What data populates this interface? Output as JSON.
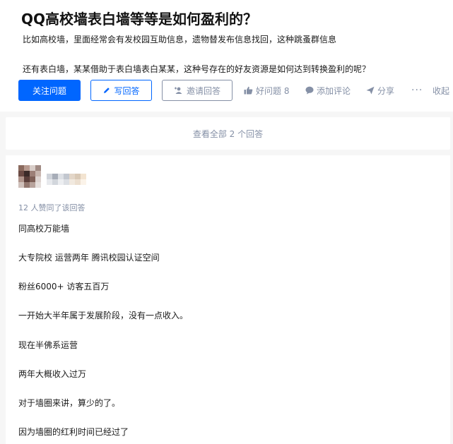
{
  "question": {
    "title": "QQ高校墙表白墙等等是如何盈利的？",
    "detail_1": "比如高校墙，里面经常会有发校园互助信息，遗物替发布信息找回，这种跳蚤群信息",
    "detail_2": "还有表白墙，某某借助于表白墙表白某某，这种号存在的好友资源是如何达到转换盈利的呢？"
  },
  "actions": {
    "follow": "关注问题",
    "write": "写回答",
    "invite": "邀请回答",
    "good_question": "好问题 8",
    "comment": "添加评论",
    "share": "分享",
    "more": "···",
    "collapse": "收起"
  },
  "view_all": "查看全部 2 个回答",
  "answer": {
    "votes": "12 人赞同了该回答",
    "lines": [
      "同高校万能墙",
      "大专院校 运营两年 腾讯校园认证空间",
      "粉丝6000+ 访客五百万",
      "一开始大半年属于发展阶段，没有一点收入。",
      "现在半佛系运营",
      "两年大概收入过万",
      "对于墙圈来讲，算少的了。",
      "因为墙圈的红利时间已经过了"
    ]
  },
  "colors": {
    "accent": "#0066ff",
    "muted": "#8590a6",
    "page_bg": "#f6f6f6"
  },
  "icons": [
    "pen-icon",
    "invite-icon",
    "thumb-up-icon",
    "comment-icon",
    "share-icon"
  ]
}
